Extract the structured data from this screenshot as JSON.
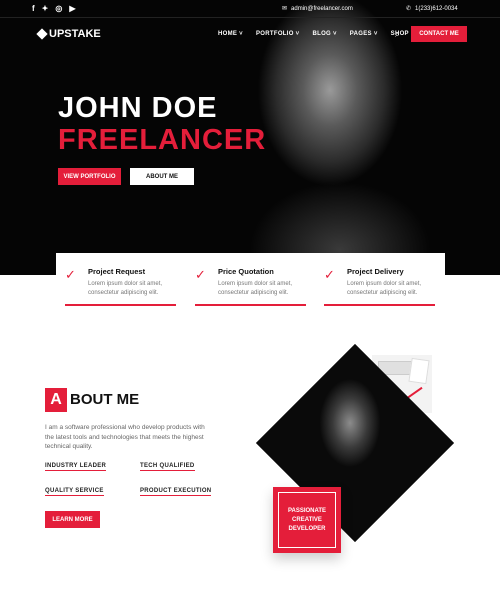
{
  "topbar": {
    "social_icons": [
      "facebook-icon",
      "twitter-icon",
      "instagram-icon",
      "youtube-icon"
    ],
    "email": "admin@freelancer.com",
    "phone": "1(233)612-0034"
  },
  "header": {
    "logo": "UPSTAKE",
    "nav": [
      "HOME",
      "PORTFOLIO",
      "BLOG",
      "PAGES",
      "SHOP"
    ],
    "contact_button": "CONTACT ME"
  },
  "hero": {
    "name": "JOHN DOE",
    "role": "FREELANCER",
    "primary_button": "VIEW PORTFOLIO",
    "secondary_button": "ABOUT ME"
  },
  "features": [
    {
      "title": "Project Request",
      "text": "Lorem ipsum dolor sit amet, consectetur adipiscing elit."
    },
    {
      "title": "Price Quotation",
      "text": "Lorem ipsum dolor sit amet, consectetur adipiscing elit."
    },
    {
      "title": "Project Delivery",
      "text": "Lorem ipsum dolor sit amet, consectetur adipiscing elit."
    }
  ],
  "about": {
    "title_first": "A",
    "title_rest": "BOUT ME",
    "text": "I am a software professional who develop products with the latest tools and technologies that meets the highest technical quality.",
    "skills": [
      "INDUSTRY LEADER",
      "TECH QUALIFIED",
      "QUALITY SERVICE",
      "PRODUCT EXECUTION"
    ],
    "button": "LEARN MORE",
    "badge_lines": [
      "PASSIONATE",
      "CREATIVE",
      "DEVELOPER"
    ]
  },
  "colors": {
    "accent": "#e41e3a",
    "dark": "#050505"
  }
}
